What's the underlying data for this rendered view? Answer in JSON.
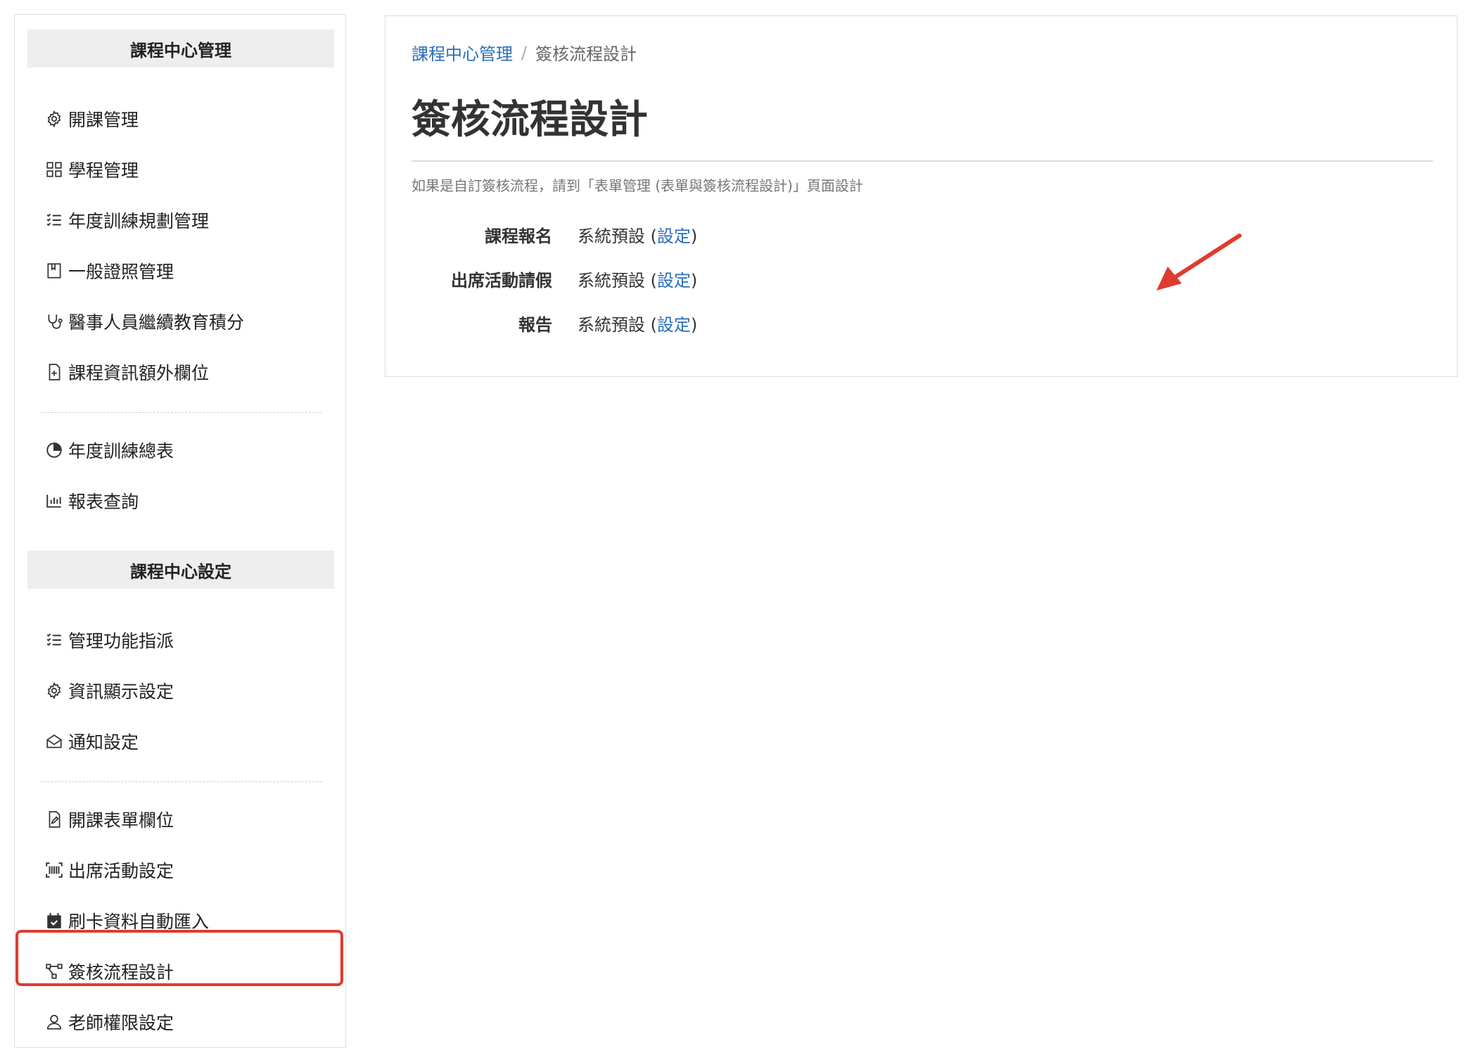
{
  "sidebar": {
    "section1_title": "課程中心管理",
    "section1_items": [
      {
        "label": "開課管理",
        "icon": "gear-icon"
      },
      {
        "label": "學程管理",
        "icon": "grid-icon"
      },
      {
        "label": "年度訓練規劃管理",
        "icon": "checklist-icon"
      },
      {
        "label": "一般證照管理",
        "icon": "bookmark-book-icon"
      },
      {
        "label": "醫事人員繼續教育積分",
        "icon": "stethoscope-icon"
      },
      {
        "label": "課程資訊額外欄位",
        "icon": "file-plus-icon"
      },
      {
        "label": "年度訓練總表",
        "icon": "pie-chart-icon"
      },
      {
        "label": "報表查詢",
        "icon": "bar-chart-icon"
      }
    ],
    "section2_title": "課程中心設定",
    "section2_items": [
      {
        "label": "管理功能指派",
        "icon": "checklist-icon"
      },
      {
        "label": "資訊顯示設定",
        "icon": "gear-icon"
      },
      {
        "label": "通知設定",
        "icon": "envelope-open-icon"
      },
      {
        "label": "開課表單欄位",
        "icon": "file-edit-icon"
      },
      {
        "label": "出席活動設定",
        "icon": "barcode-scan-icon"
      },
      {
        "label": "刷卡資料自動匯入",
        "icon": "calendar-check-icon"
      },
      {
        "label": "簽核流程設計",
        "icon": "workflow-icon"
      },
      {
        "label": "老師權限設定",
        "icon": "user-icon"
      }
    ]
  },
  "breadcrumb": {
    "parent": "課程中心管理",
    "separator": "/",
    "current": "簽核流程設計"
  },
  "page": {
    "title": "簽核流程設計",
    "hint": "如果是自訂簽核流程，請到「表單管理 (表單與簽核流程設計)」頁面設計"
  },
  "settings": [
    {
      "label": "課程報名",
      "value": "系統預設",
      "open": "(",
      "link": "設定",
      "close": ")"
    },
    {
      "label": "出席活動請假",
      "value": "系統預設",
      "open": "(",
      "link": "設定",
      "close": ")"
    },
    {
      "label": "報告",
      "value": "系統預設",
      "open": "(",
      "link": "設定",
      "close": ")"
    }
  ],
  "colors": {
    "link": "#2a6ebb",
    "highlight": "#e03a2f",
    "section_bg": "#eeeeee"
  }
}
